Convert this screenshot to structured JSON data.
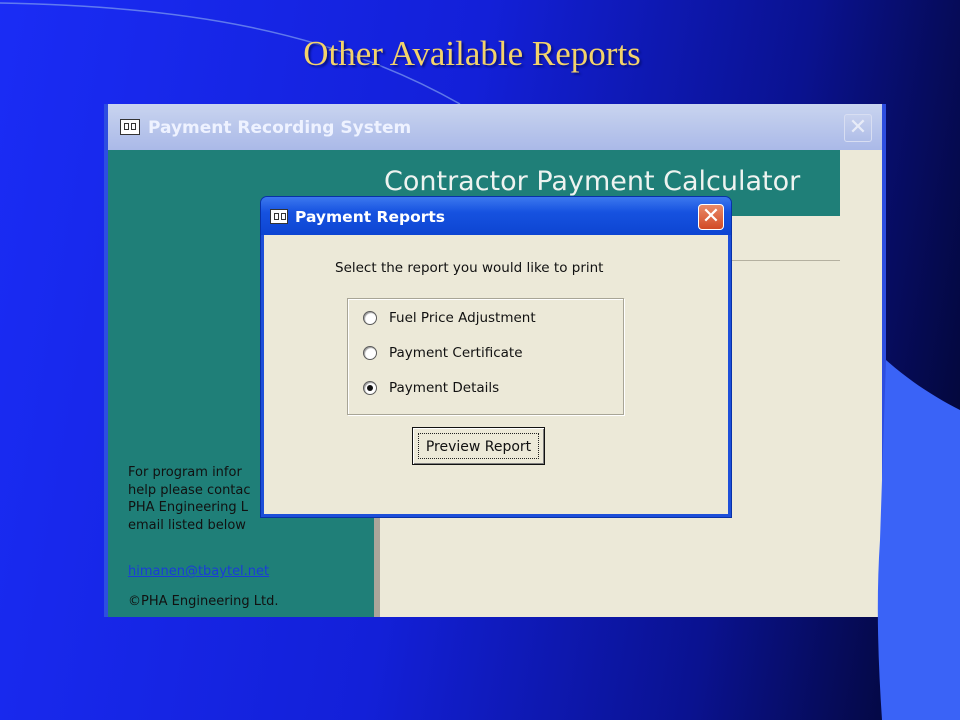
{
  "slide": {
    "title": "Other Available Reports"
  },
  "window": {
    "title": "Payment Recording System",
    "close_glyph": "✕",
    "banner_title": "Contractor Payment Calculator"
  },
  "sidebar": {
    "lines": [
      "For program infor",
      "help please contac",
      "PHA Engineering L",
      "email listed below"
    ],
    "email_link": "himanen@tbaytel.net",
    "copyright": "©PHA Engineering Ltd."
  },
  "dialog": {
    "title": "Payment Reports",
    "close_glyph": "✕",
    "prompt": "Select the report you would like to print",
    "options": [
      {
        "label": "Fuel Price Adjustment",
        "checked": false
      },
      {
        "label": "Payment Certificate",
        "checked": false
      },
      {
        "label": "Payment Details",
        "checked": true
      }
    ],
    "preview_button": "Preview Report"
  },
  "icons": {
    "app": "form-icon"
  },
  "colors": {
    "slide_title": "#f3d36b",
    "teal": "#1f7f78",
    "xp_blue": "#1d4fd9",
    "form_bg": "#ece9d8"
  }
}
